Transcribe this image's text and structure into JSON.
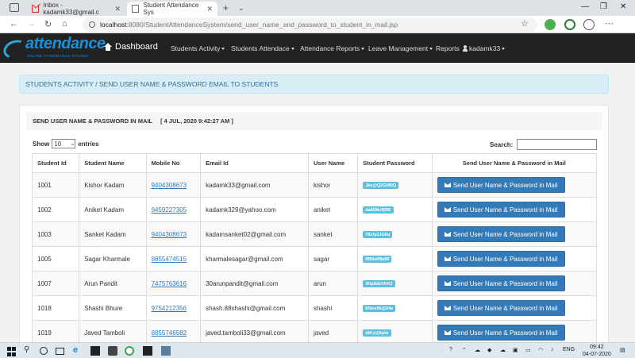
{
  "browser": {
    "tabs": [
      {
        "label": "Inbox - kadamk33@gmail.c",
        "active": false
      },
      {
        "label": "Student Attendance Sys",
        "active": true
      }
    ],
    "url_host": "localhost",
    "url_path": ":8080/StudentAttendanceSystem/send_user_name_and_password_to_student_in_mail.jsp"
  },
  "app": {
    "logo_text": "attendance",
    "logo_tagline": "ONLINE ATTENDANCE SYSTEM",
    "brand": "Dashboard",
    "menu": [
      "Students Activity",
      "Students Attendace",
      "Attendance Reports",
      "Leave Management",
      "Reports"
    ],
    "user": "kadamk33"
  },
  "breadcrumb": "STUDENTS ACTIVITY / SEND USER NAME & PASSWORD EMAIL TO STUDENTS",
  "panel": {
    "title": "SEND USER NAME & PASSWORD IN MAIL",
    "date": "[ 4 JUL, 2020 9:42:27 AM ]"
  },
  "table_controls": {
    "show_label": "Show",
    "page_size": "10",
    "entries_label": "entries",
    "search_label": "Search:"
  },
  "table": {
    "headers": [
      "Student Id",
      "Student Name",
      "Mobile No",
      "Email Id",
      "User Name",
      "Student Password",
      "Send User Name & Password in Mail"
    ],
    "button_label": "Send User Name & Password in Mail",
    "rows": [
      {
        "id": "1001",
        "name": "Kishor Kadam",
        "mobile": "9404308673",
        "email": "kadamk33@gmail.com",
        "username": "kishor",
        "password": "Jks@Q2GMNQ"
      },
      {
        "id": "1002",
        "name": "Aniket Kadam",
        "mobile": "9459227305",
        "email": "kadamk329@yahoo.com",
        "username": "aniket",
        "password": "da85Mc9jRE"
      },
      {
        "id": "1003",
        "name": "Sanket Kadam",
        "mobile": "9404308673",
        "email": "kadamsanket02@gmail.com",
        "username": "sanket",
        "password": "T6zfy2JG6q"
      },
      {
        "id": "1005",
        "name": "Sagar Kharmale",
        "mobile": "8855474515",
        "email": "kharmalesagar@gmail.com",
        "username": "sagar",
        "password": "0BNsR8a89"
      },
      {
        "id": "1007",
        "name": "Arun Pandit",
        "mobile": "7475763616",
        "email": "30arunpandit@gmail.com",
        "username": "arun",
        "password": "3Hp8deVKK2"
      },
      {
        "id": "1018",
        "name": "Shashi Bhure",
        "mobile": "9754212356",
        "email": "shash.88shashi@gmail.com",
        "username": "shashi",
        "password": "KNov9k@24e"
      },
      {
        "id": "1019",
        "name": "Javed Tamboli",
        "mobile": "8855746582",
        "email": "javed.tamboli33@gmail.com",
        "username": "javed",
        "password": "dtKy@6pbr"
      }
    ]
  },
  "taskbar": {
    "language": "ENG",
    "time": "09:42",
    "date": "04-07-2020"
  }
}
